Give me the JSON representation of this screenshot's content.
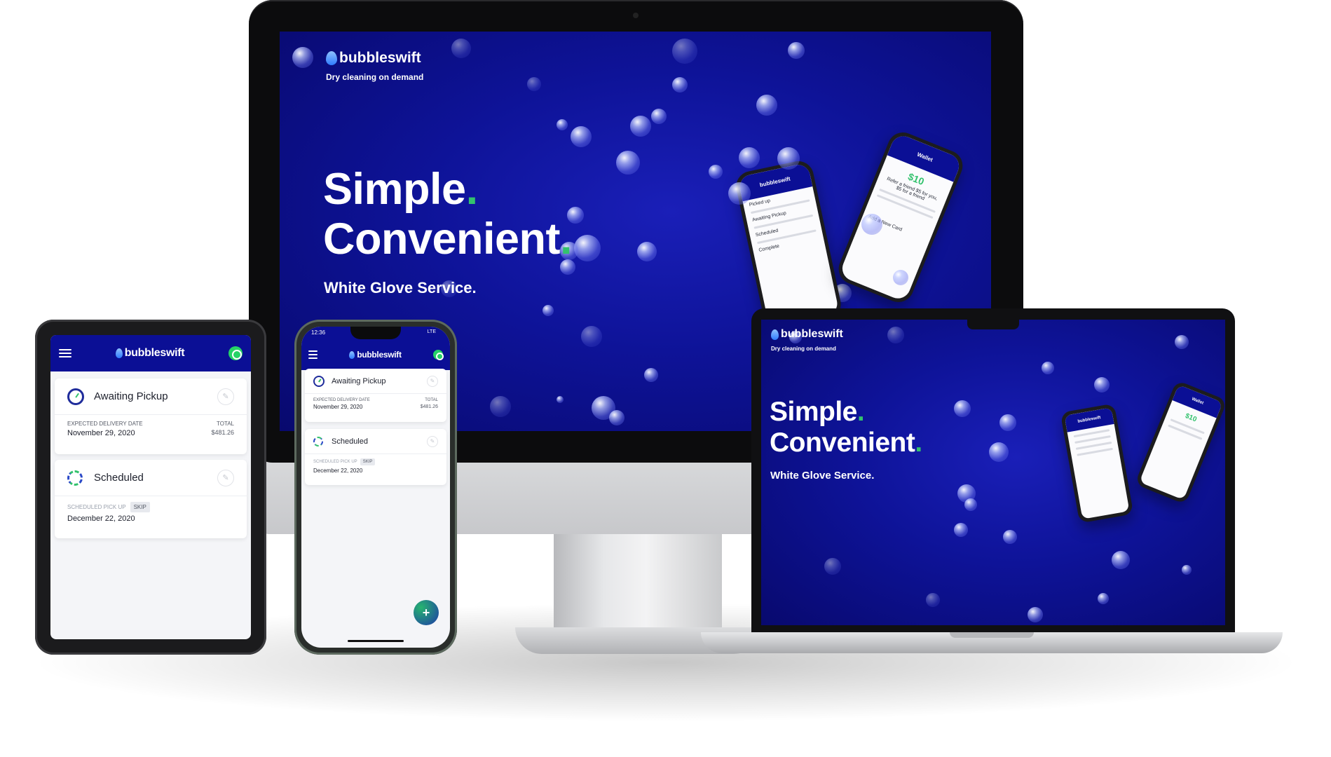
{
  "brand": {
    "name": "bubbleswift",
    "tagline": "Dry cleaning on demand",
    "primary_color": "#0b0f95",
    "accent_color": "#33c26d"
  },
  "hero": {
    "line1": "Simple",
    "line2": "Convenient",
    "dot": ".",
    "subtitle": "White Glove Service."
  },
  "mini_phone": {
    "left_header": "bubbleswift",
    "right_header": "Wallet",
    "wallet_amount": "$10",
    "refer_text": "Refer a friend $5 for you, $5 for a friend",
    "add_card": "Add a New Card",
    "item_pickup": "Picked up",
    "item_awaiting": "Awaiting Pickup",
    "item_scheduled": "Scheduled",
    "item_complete": "Complete"
  },
  "orders": [
    {
      "status": "Awaiting Pickup",
      "status_icon": "clock-icon",
      "date_label": "EXPECTED DELIVERY DATE",
      "date": "November 29, 2020",
      "total_label": "TOTAL",
      "total": "$481.26"
    },
    {
      "status": "Scheduled",
      "status_icon": "refresh-icon",
      "date_label": "SCHEDULED PICK UP",
      "skip_label": "SKIP",
      "date": "December 22, 2020"
    }
  ],
  "phone_status": {
    "time": "12:36",
    "network": "LTE"
  },
  "fab": {
    "label": "+"
  },
  "icons": {
    "menu": "hamburger-icon",
    "whatsapp": "whatsapp-icon",
    "edit": "pencil-icon",
    "add": "plus-icon"
  }
}
